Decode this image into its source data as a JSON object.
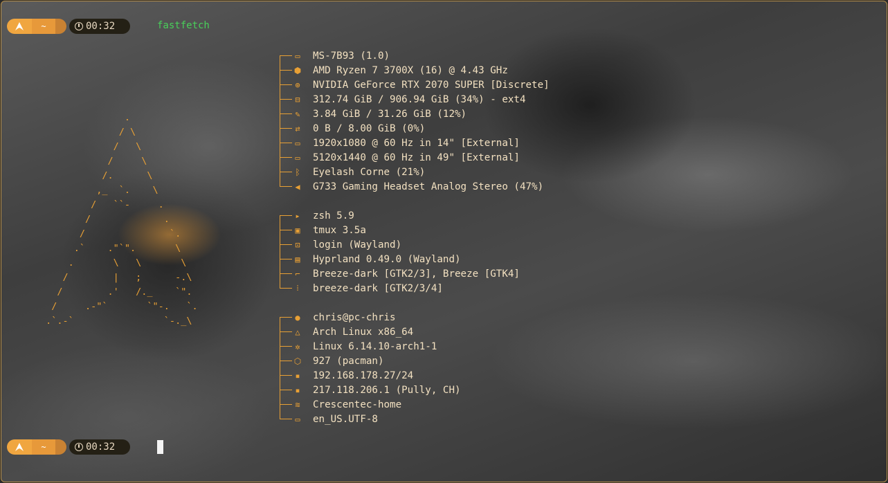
{
  "prompt": {
    "dir": "~",
    "time": "00:32",
    "command": "fastfetch"
  },
  "logo_lines": [
    "          .",
    "         / \\",
    "        /   \\",
    "       /^.   \\",
    "      /  .-.  \\",
    "     /  (   ) _\\",
    "    _/  _.~   ~._^\\",
    "   /.^          ^.\\"
  ],
  "logo_art": "               .\n              / \\\n             /   \\\n            /     \\\n           /.      \\\n          ,_  `.    \\\n         /   ``-     .\n        /             .\n       /               `.\n      .`    .\"`\".       \\\n     .       \\   \\       \\\n    /        |   ;      -.\\\n   /        .'   /._    `\".\n  /     .-\"`       `\"-.   `.\n .`.-`                `-._\\",
  "groups": [
    [
      {
        "icon": "laptop-icon",
        "glyph": "▭",
        "value": "MS-7B93 (1.0)"
      },
      {
        "icon": "cpu-icon",
        "glyph": "⬢",
        "value": "AMD Ryzen 7 3700X (16) @ 4.43 GHz"
      },
      {
        "icon": "gpu-icon",
        "glyph": "⊕",
        "value": "NVIDIA GeForce RTX 2070 SUPER [Discrete]"
      },
      {
        "icon": "disk-icon",
        "glyph": "⊟",
        "value": "312.74 GiB / 906.94 GiB (34%) - ext4"
      },
      {
        "icon": "memory-icon",
        "glyph": "✎",
        "value": "3.84 GiB / 31.26 GiB (12%)"
      },
      {
        "icon": "swap-icon",
        "glyph": "⇄",
        "value": "0 B / 8.00 GiB (0%)"
      },
      {
        "icon": "monitor-icon",
        "glyph": "▭",
        "value": "1920x1080 @ 60 Hz in 14\" [External]"
      },
      {
        "icon": "monitor-icon",
        "glyph": "▭",
        "value": "5120x1440 @ 60 Hz in 49\" [External]"
      },
      {
        "icon": "bluetooth-icon",
        "glyph": "ᛒ",
        "value": "Eyelash Corne (21%)"
      },
      {
        "icon": "speaker-icon",
        "glyph": "◀",
        "value": "G733 Gaming Headset Analog Stereo (47%)"
      }
    ],
    [
      {
        "icon": "shell-icon",
        "glyph": "▸",
        "value": "zsh 5.9"
      },
      {
        "icon": "terminal-icon",
        "glyph": "▣",
        "value": "tmux 3.5a"
      },
      {
        "icon": "login-icon",
        "glyph": "⊡",
        "value": "login (Wayland)"
      },
      {
        "icon": "window-manager-icon",
        "glyph": "▤",
        "value": "Hyprland 0.49.0 (Wayland)"
      },
      {
        "icon": "theme-brush-icon",
        "glyph": "⌐",
        "value": "Breeze-dark [GTK2/3], Breeze [GTK4]"
      },
      {
        "icon": "icons-grid-icon",
        "glyph": "⁞",
        "value": "breeze-dark [GTK2/3/4]"
      }
    ],
    [
      {
        "icon": "user-icon",
        "glyph": "●",
        "value": "chris@pc-chris"
      },
      {
        "icon": "tux-icon",
        "glyph": "△",
        "value": "Arch Linux x86_64"
      },
      {
        "icon": "kernel-gear-icon",
        "glyph": "✲",
        "value": "Linux 6.14.10-arch1-1"
      },
      {
        "icon": "package-icon",
        "glyph": "⬡",
        "value": "927 (pacman)"
      },
      {
        "icon": "local-ip-icon",
        "glyph": "▪",
        "value": "192.168.178.27/24"
      },
      {
        "icon": "public-ip-icon",
        "glyph": "▪",
        "value": "217.118.206.1 (Pully, CH)"
      },
      {
        "icon": "wifi-icon",
        "glyph": "≋",
        "value": "Crescentec-home"
      },
      {
        "icon": "locale-icon",
        "glyph": "▭",
        "value": "en_US.UTF-8"
      }
    ]
  ],
  "colors": {
    "accent": "#e8a035",
    "text": "#f3e1c1",
    "command": "#49d05a"
  }
}
